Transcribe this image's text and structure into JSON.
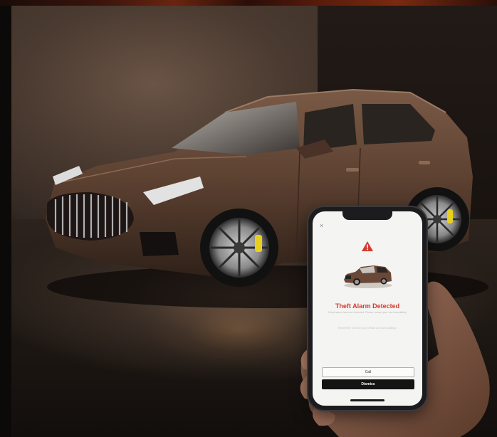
{
  "scene": {
    "subject": "brown SUV in studio with smartphone held in hand",
    "colors": {
      "car_body": "#5a3a2a",
      "alert_red": "#d63a2f",
      "caliper_yellow": "#e8d020",
      "phone_screen": "#f4f4f2"
    }
  },
  "phone_app": {
    "close_icon": "×",
    "warning_icon": "warning-triangle-icon",
    "title": "Theft Alarm Detected",
    "body_text": "A theft alarm has been detected. Please contact your car immediately.",
    "note_text": "Remember to check your vehicle and surroundings.",
    "call_label": "Call",
    "dismiss_label": "Dismiss"
  }
}
